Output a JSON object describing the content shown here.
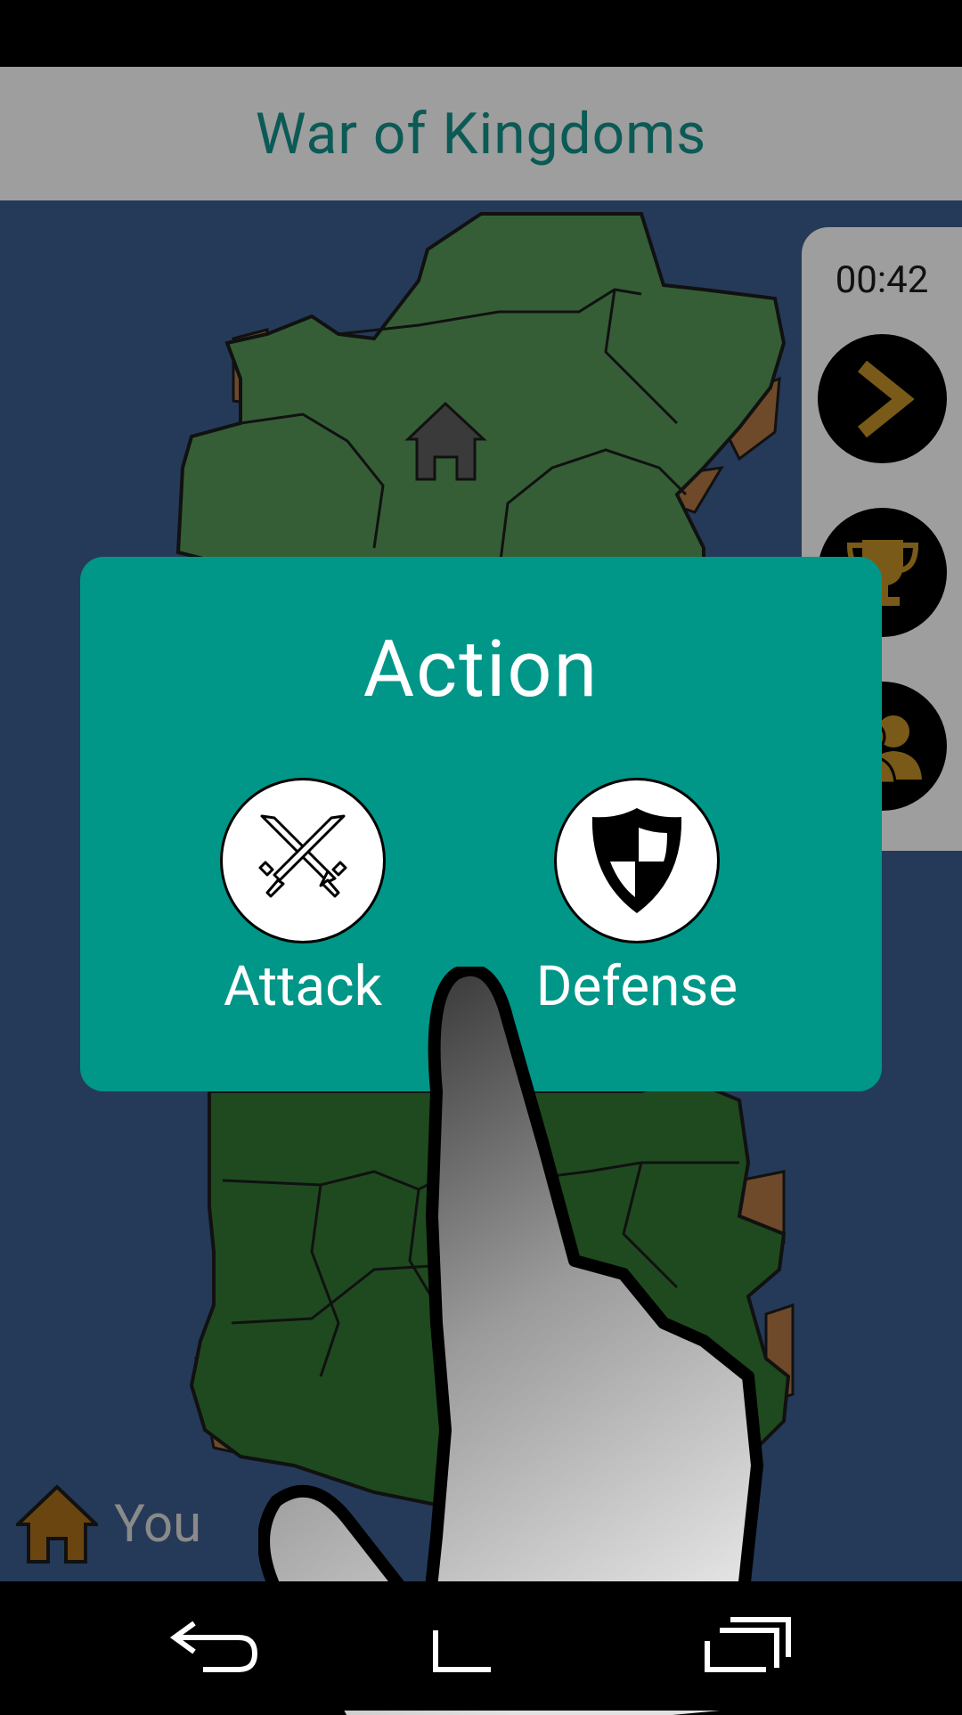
{
  "app": {
    "title": "War of Kingdoms"
  },
  "side_panel": {
    "timer": "00:42",
    "buttons": [
      {
        "icon": "chevron-right-icon"
      },
      {
        "icon": "trophy-icon"
      },
      {
        "icon": "players-icon"
      }
    ]
  },
  "player": {
    "name": "You",
    "icon": "home-icon"
  },
  "dialog": {
    "title": "Action",
    "actions": [
      {
        "label": "Attack",
        "icon": "crossed-swords-icon"
      },
      {
        "label": "Defense",
        "icon": "shield-icon"
      }
    ]
  },
  "colors": {
    "app_bar": "#9e9e9e",
    "title_text": "#0b5a55",
    "sea": "#253a58",
    "dialog": "#009688",
    "accent_gold": "#7a5a18",
    "home_brown": "#6b4510"
  },
  "nav": {
    "buttons": [
      {
        "icon": "back-icon"
      },
      {
        "icon": "home-icon"
      },
      {
        "icon": "recents-icon"
      }
    ]
  }
}
